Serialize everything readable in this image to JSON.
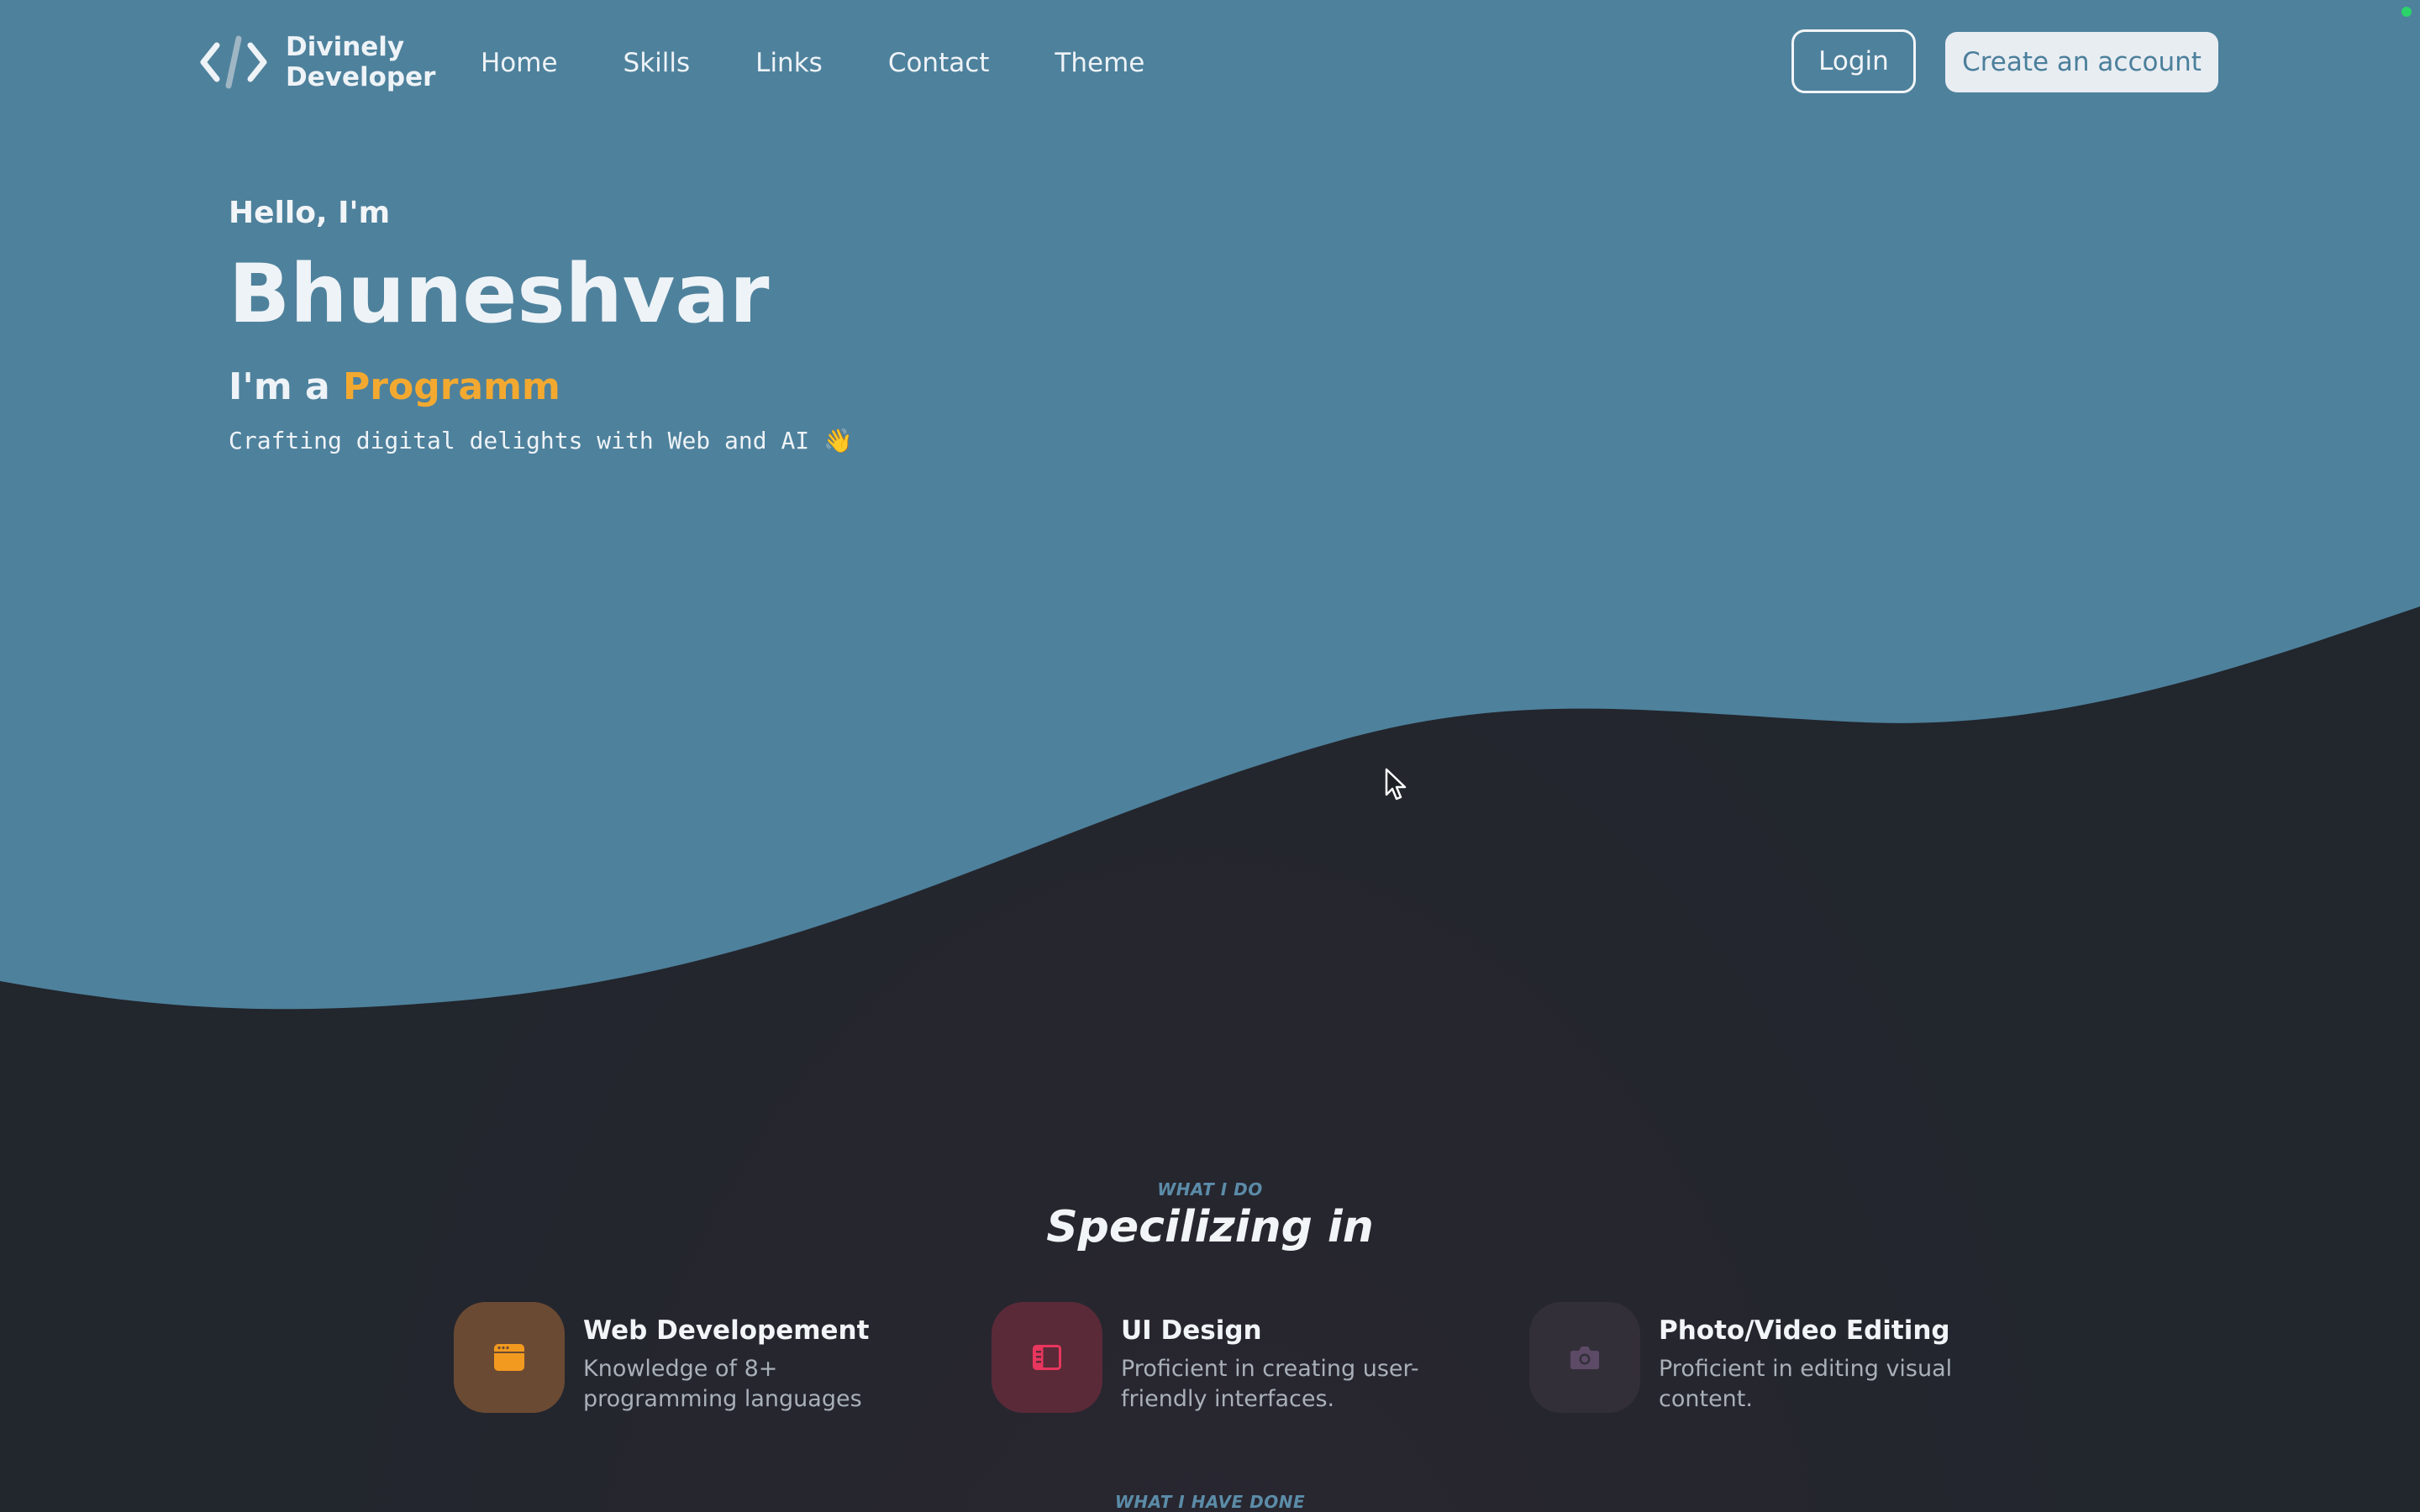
{
  "nav": {
    "logo_line1": "Divinely",
    "logo_line2": "Developer",
    "links": [
      "Home",
      "Skills",
      "Links",
      "Contact",
      "Theme"
    ],
    "login_label": "Login",
    "create_label": "Create an account"
  },
  "hero": {
    "greeting": "Hello, I'm",
    "name": "Bhuneshvar",
    "role_prefix": "I'm a",
    "role_typed": "Programm",
    "tagline": "Crafting digital delights with Web and AI 👋"
  },
  "what_i_do": {
    "eyebrow": "WHAT I DO",
    "title": "Specilizing in",
    "cards": [
      {
        "title": "Web Developement",
        "desc": "Knowledge of 8+ programming languages",
        "icon": "browser-window-icon",
        "accent": "#f29a1f",
        "bg": "#6b4a33"
      },
      {
        "title": "UI Design",
        "desc": "Proficient in creating user-friendly interfaces.",
        "icon": "layout-icon",
        "accent": "#e8365e",
        "bg": "#5a2a38"
      },
      {
        "title": "Photo/Video Editing",
        "desc": "Proficient in editing visual content.",
        "icon": "camera-icon",
        "accent": "#5c4a66",
        "bg": "#332f39"
      }
    ]
  },
  "next_section": {
    "eyebrow": "WHAT I HAVE DONE"
  },
  "colors": {
    "hero_blue": "#4e819c",
    "dark_bg": "#22262d",
    "accent_orange": "#f3a930"
  }
}
